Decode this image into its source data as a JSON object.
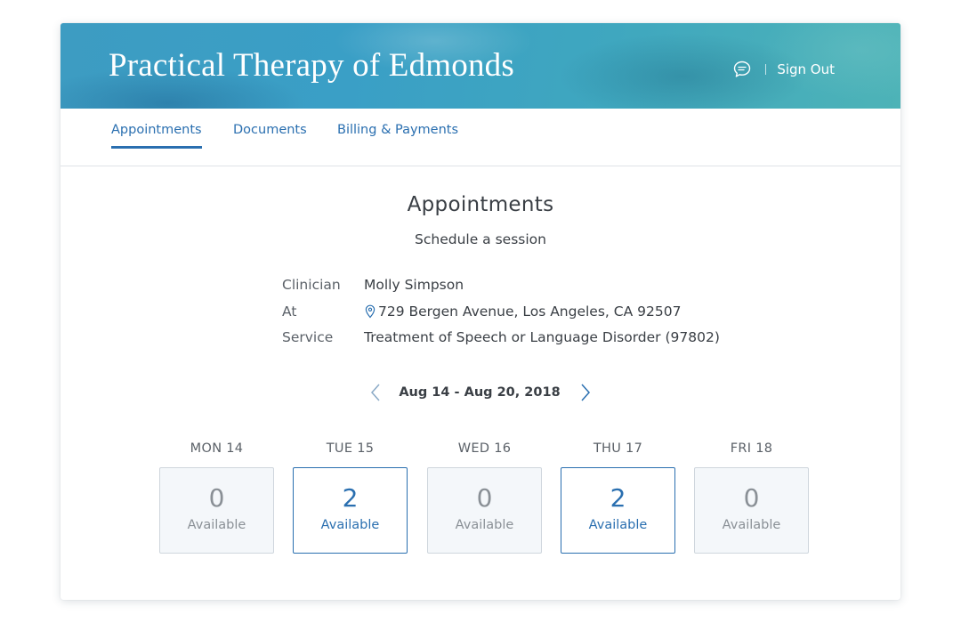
{
  "header": {
    "practice_name": "Practical Therapy of Edmonds",
    "sign_out_label": "Sign Out",
    "chat_icon": "chat-bubble-icon"
  },
  "tabs": [
    {
      "label": "Appointments",
      "active": true
    },
    {
      "label": "Documents",
      "active": false
    },
    {
      "label": "Billing & Payments",
      "active": false
    }
  ],
  "main": {
    "title": "Appointments",
    "subtitle": "Schedule a session"
  },
  "details": {
    "clinician_label": "Clinician",
    "clinician_value": "Molly Simpson",
    "at_label": "At",
    "at_value": "729 Bergen Avenue, Los Angeles, CA 92507",
    "service_label": "Service",
    "service_value": "Treatment of Speech or Language Disorder (97802)"
  },
  "week": {
    "range": "Aug 14 - Aug 20, 2018"
  },
  "days": [
    {
      "label": "MON 14",
      "count": "0",
      "available_label": "Available"
    },
    {
      "label": "TUE 15",
      "count": "2",
      "available_label": "Available"
    },
    {
      "label": "WED 16",
      "count": "0",
      "available_label": "Available"
    },
    {
      "label": "THU 17",
      "count": "2",
      "available_label": "Available"
    },
    {
      "label": "FRI 18",
      "count": "0",
      "available_label": "Available"
    }
  ],
  "colors": {
    "accent": "#2a6fb0",
    "banner": "#3fa2c3",
    "slot_empty_bg": "#f4f7fa"
  }
}
